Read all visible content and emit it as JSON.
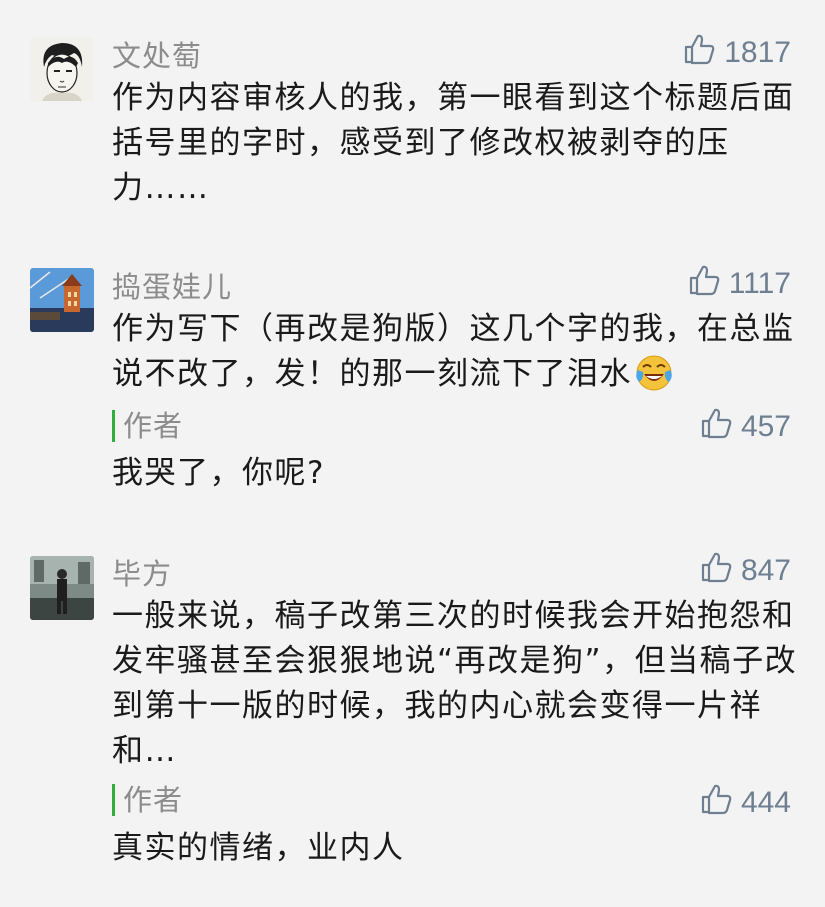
{
  "comments": [
    {
      "username": "文处萄",
      "likes": "1817",
      "text": "作为内容审核人的我，第一眼看到这个标题后面括号里的字时，感受到了修改权被剥夺的压力……"
    },
    {
      "username": "捣蛋娃儿",
      "likes": "1117",
      "text": "作为写下（再改是狗版）这几个字的我，在总监说不改了，发！的那一刻流下了泪水",
      "emoji": "crying-laughing-emoji",
      "reply": {
        "tag": "作者",
        "likes": "457",
        "text": "我哭了，你呢?"
      }
    },
    {
      "username": "毕方",
      "likes": "847",
      "text": "一般来说，稿子改第三次的时候我会开始抱怨和发牢骚甚至会狠狠地说“再改是狗”，但当稿子改到第十一版的时候，我的内心就会变得一片祥和…",
      "reply": {
        "tag": "作者",
        "likes": "444",
        "text": "真实的情绪，业内人"
      }
    }
  ],
  "icons": {
    "like": "thumbs-up-icon"
  },
  "colors": {
    "author_bar": "#2fae3b",
    "like": "#6f7f92",
    "meta": "#8c8c8c"
  }
}
